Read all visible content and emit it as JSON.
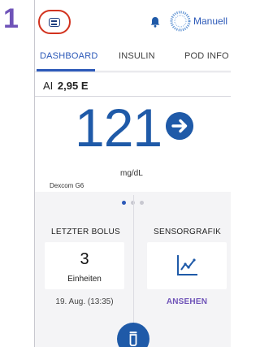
{
  "step_number": "1",
  "header": {
    "mode_label": "Manuell",
    "menu_icon": "menu-icon",
    "bell_icon": "bell-icon",
    "mode_icon": "automated-mode-ring-icon"
  },
  "tabs": [
    {
      "label": "DASHBOARD",
      "active": true
    },
    {
      "label": "INSULIN",
      "active": false
    },
    {
      "label": "POD INFO",
      "active": false
    }
  ],
  "dashboard": {
    "iob_label": "AI",
    "iob_value": "2,95 E",
    "glucose_value": "121",
    "glucose_unit": "mg/dL",
    "trend_icon": "arrow-right-icon",
    "cgm_source": "Dexcom G6"
  },
  "pager": {
    "count": 3,
    "active_index": 0
  },
  "last_bolus": {
    "title": "LETZTER BOLUS",
    "value": "3",
    "unit": "Einheiten",
    "date": "19. Aug. (13:35)"
  },
  "sensor_graph": {
    "title": "SENSORGRAFIK",
    "icon": "line-graph-icon",
    "link_label": "ANSEHEN"
  },
  "colors": {
    "primary_blue": "#1f5aa8",
    "purple_accent": "#6f53b8",
    "highlight_red": "#d2321e"
  }
}
